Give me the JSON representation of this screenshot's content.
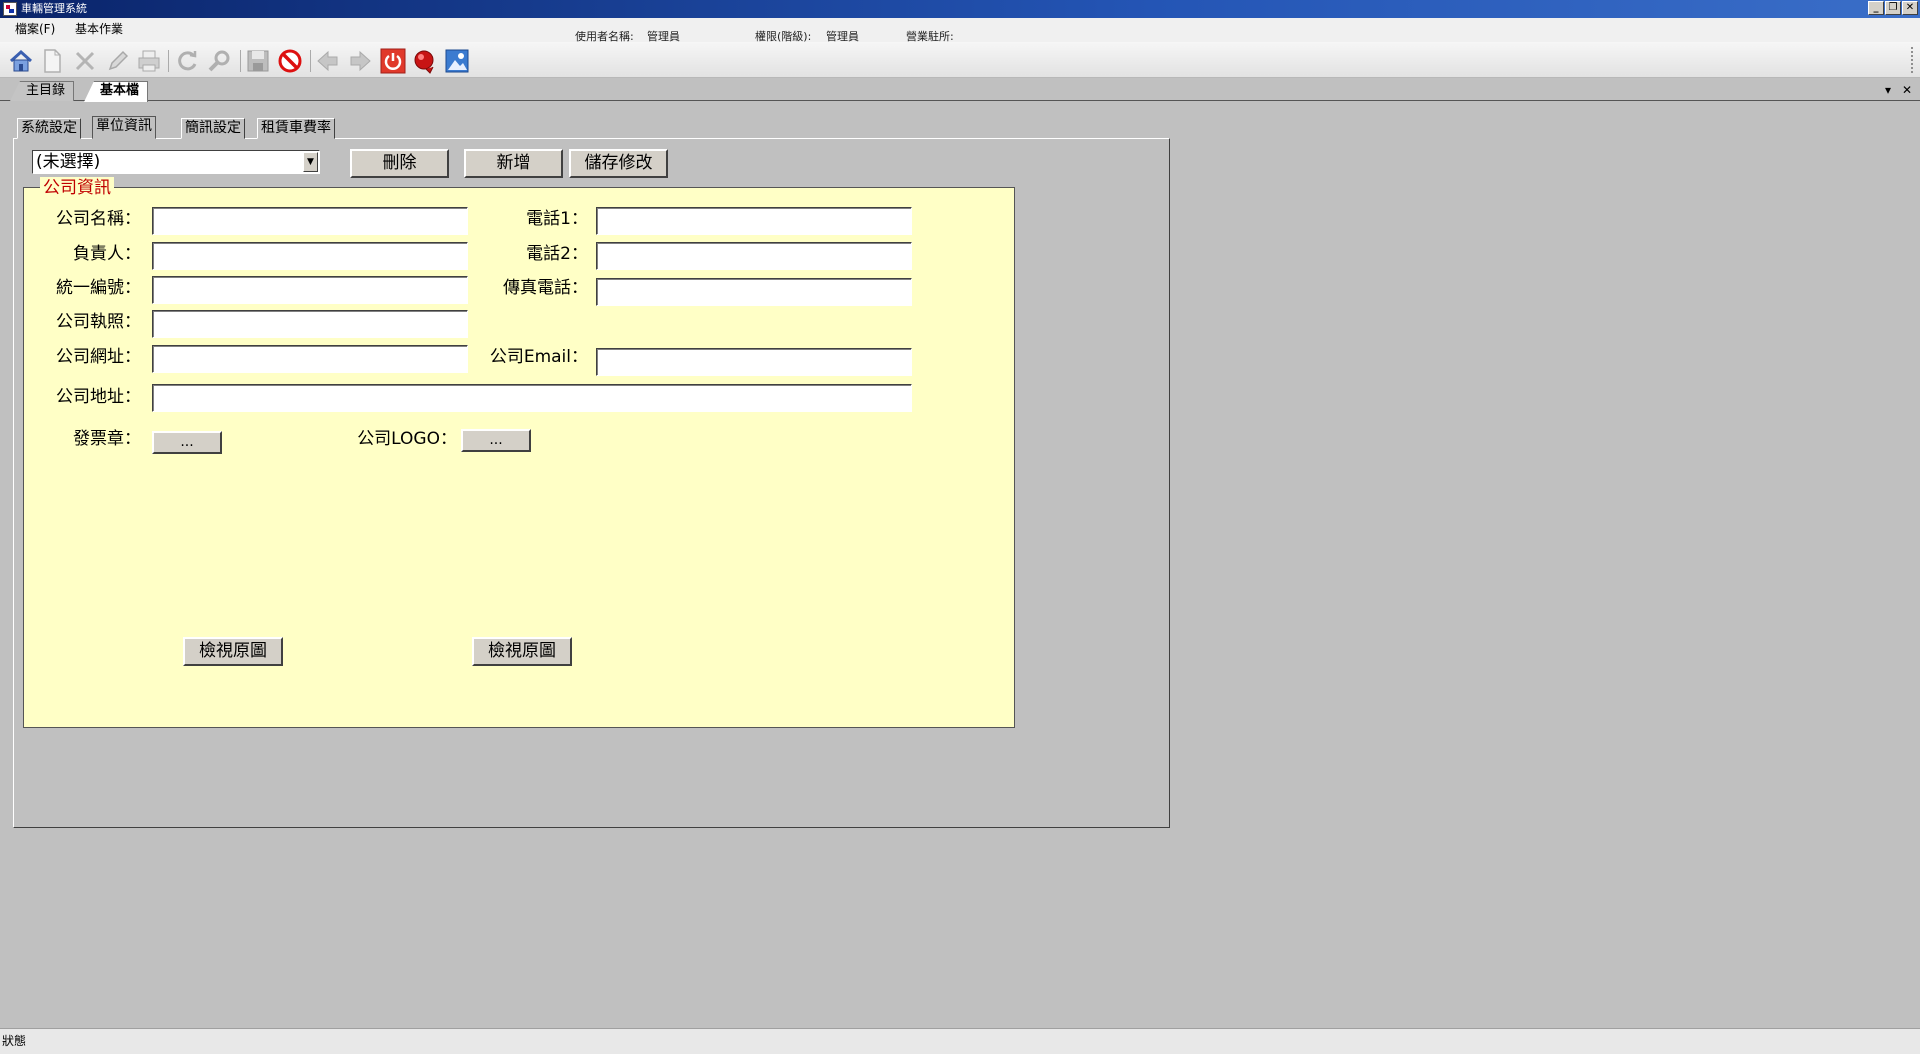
{
  "window": {
    "title": "車輛管理系統",
    "minimize": "_",
    "restore": "❐",
    "close": "✕"
  },
  "menu": {
    "items": [
      {
        "label": "檔案(F)"
      },
      {
        "label": "基本作業"
      }
    ]
  },
  "user_info": {
    "user_label": "使用者名稱:",
    "user_value": "管理員",
    "role_label": "權限(階級):",
    "role_value": "管理員",
    "office_label": "營業駐所:",
    "office_value": ""
  },
  "toolbar": {
    "icons": [
      "home-icon",
      "new-document-icon",
      "delete-icon",
      "edit-icon",
      "print-icon",
      "refresh-icon",
      "search-icon",
      "save-icon",
      "stop-icon",
      "previous-icon",
      "next-icon",
      "power-icon",
      "alarm-icon",
      "picture-icon"
    ],
    "disabled": [
      "new-document-icon",
      "delete-icon",
      "edit-icon",
      "print-icon",
      "refresh-icon",
      "search-icon",
      "save-icon",
      "previous-icon",
      "next-icon"
    ]
  },
  "doc_tabs": [
    {
      "label": "主目錄",
      "active": false
    },
    {
      "label": "基本檔",
      "active": true
    }
  ],
  "doc_tab_controls": {
    "dropdown": "▾",
    "close": "✕"
  },
  "inner_tabs": [
    {
      "label": "系統設定",
      "active": false
    },
    {
      "label": "單位資訊",
      "active": true
    },
    {
      "label": "簡訊設定",
      "active": false
    },
    {
      "label": "租賃車費率",
      "active": false
    }
  ],
  "form": {
    "unit_select": {
      "value": "(未選擇)",
      "arrow": "▼"
    },
    "delete_label": "刪除",
    "add_label": "新增",
    "save_label": "儲存修改",
    "group_title": "公司資訊",
    "labels": {
      "company_name": "公司名稱：",
      "principal": "負責人：",
      "tax_id": "統一編號：",
      "license": "公司執照：",
      "website": "公司網址：",
      "address": "公司地址：",
      "phone1": "電話1：",
      "phone2": "電話2：",
      "fax": "傳真電話：",
      "email": "公司Email：",
      "invoice_stamp": "發票章：",
      "logo": "公司LOGO："
    },
    "values": {
      "company_name": "",
      "principal": "",
      "tax_id": "",
      "license": "",
      "website": "",
      "address": "",
      "phone1": "",
      "phone2": "",
      "fax": "",
      "email": ""
    },
    "browse_label": "...",
    "view_original_label": "檢視原圖"
  },
  "statusbar": {
    "text": "狀態"
  },
  "colors": {
    "title_bar": "#0a246a",
    "group_background": "#ffffc6",
    "group_title": "#c00000",
    "workspace": "#c0c0c0"
  }
}
